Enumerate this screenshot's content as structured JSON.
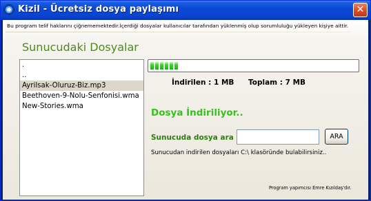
{
  "window": {
    "title": "Kizil - Ücretsiz dosya paylaşımı",
    "close_symbol": "✕"
  },
  "notice": "Bu program telif haklarını çiğnememektedir.İçerdiği dosyalar kullanıcılar tarafından yüklenmiş olup sorumluluğu yükleyen kişiye aittir.",
  "server": {
    "heading": "Sunucudaki Dosyalar",
    "files": [
      ".",
      "..",
      "Ayrilsak-Oluruz-Biz.mp3",
      "Beethoven-9-Nolu-Senfonisi.wma",
      "New-Stories.wma"
    ],
    "selected_index": 2
  },
  "download": {
    "progress_fraction": 0.14,
    "downloaded_label": "İndirilen : 1 MB",
    "total_label": "Toplam : 7 MB",
    "status": "Dosya İndiriliyor.."
  },
  "search": {
    "label": "Sunucuda dosya ara :",
    "value": "",
    "button": "ARA"
  },
  "info": "Sunucudan indirilen dosyaları C:\\ klasöründe bulabilirsiniz..",
  "credit": "Program yapımcısı Emre Kızıldaş'dır.",
  "colors": {
    "heading": "#4d8a1f",
    "status": "#35c21a",
    "progress": "#21b01a"
  },
  "icons": {
    "app": "kizil-app-icon",
    "close": "close-icon"
  }
}
